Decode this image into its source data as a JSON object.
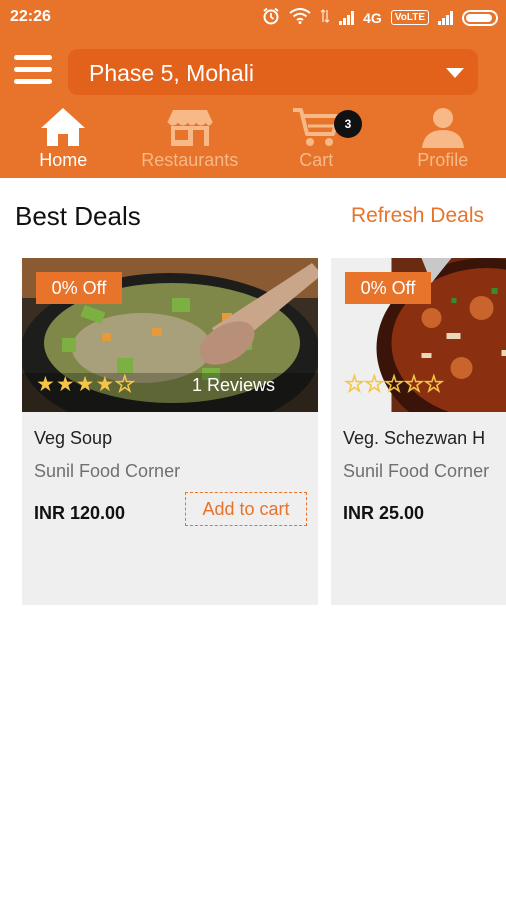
{
  "status_bar": {
    "time": "22:26",
    "network": "4G",
    "volte": "VoLTE",
    "icons": [
      "alarm-icon",
      "wifi-icon",
      "signal-icon",
      "battery-icon"
    ]
  },
  "header": {
    "location": "Phase 5, Mohali",
    "tabs": [
      {
        "label": "Home",
        "icon": "home-icon",
        "active": true
      },
      {
        "label": "Restaurants",
        "icon": "store-icon",
        "active": false
      },
      {
        "label": "Cart",
        "icon": "cart-icon",
        "active": false,
        "badge": "3"
      },
      {
        "label": "Profile",
        "icon": "profile-icon",
        "active": false
      }
    ]
  },
  "section": {
    "title": "Best Deals",
    "refresh_label": "Refresh Deals"
  },
  "deals": [
    {
      "discount": "0% Off",
      "rating": 4.5,
      "reviews": "1 Reviews",
      "name": "Veg Soup",
      "restaurant": "Sunil Food Corner",
      "price": "INR  120.00",
      "add_to_cart": "Add to cart"
    },
    {
      "discount": "0% Off",
      "rating": 0,
      "reviews": "",
      "name": "Veg. Schezwan H",
      "restaurant": "Sunil Food Corner",
      "price": "INR  25.00",
      "add_to_cart": ""
    }
  ],
  "colors": {
    "primary": "#e8732a",
    "accent_dark": "#e2621c",
    "star": "#f3c54a"
  }
}
